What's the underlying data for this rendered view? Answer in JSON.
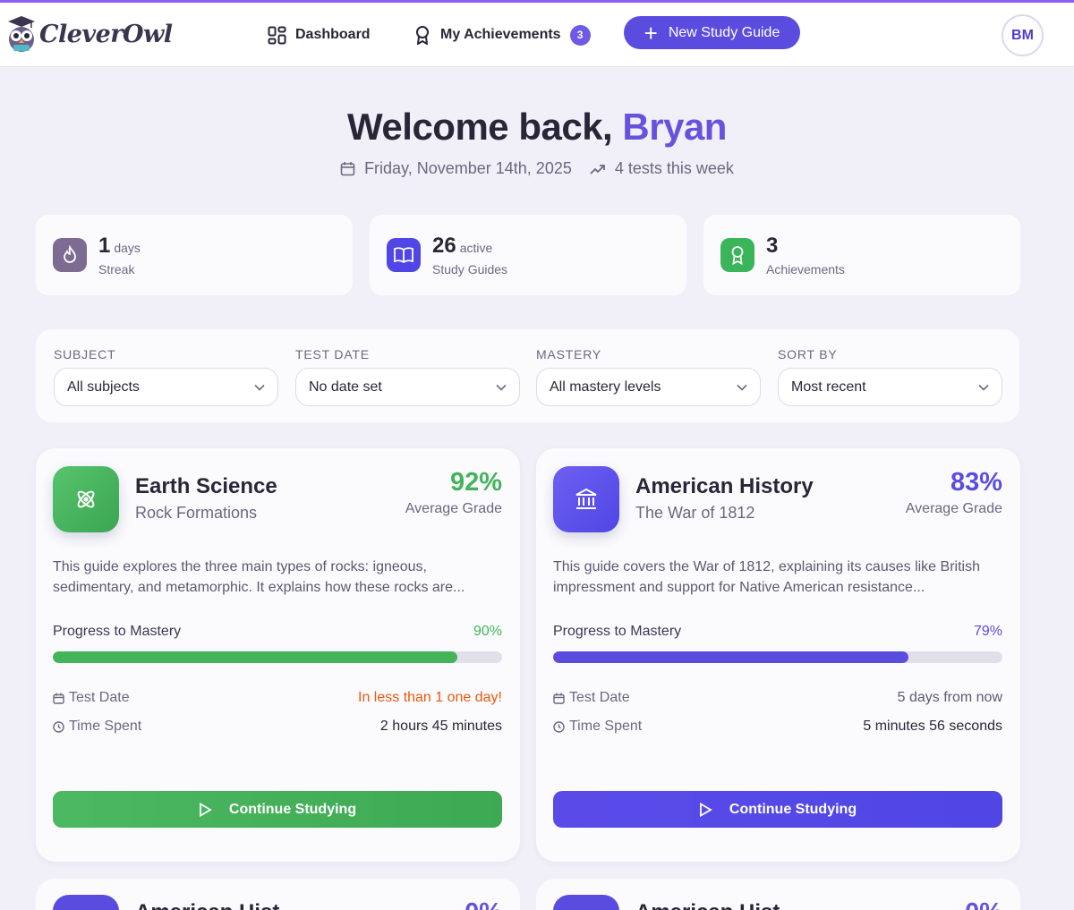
{
  "brand": {
    "name": "CleverOwl"
  },
  "nav": {
    "dashboard_label": "Dashboard",
    "achievements_label": "My Achievements",
    "achievements_count": "3",
    "new_guide_label": "New Study Guide",
    "avatar_initials": "BM"
  },
  "welcome": {
    "greeting": "Welcome back, ",
    "name": "Bryan",
    "date": "Friday, November 14th, 2025",
    "tests": "4 tests this week"
  },
  "stats": [
    {
      "value": "1",
      "unit": "days",
      "label": "Streak",
      "color": "#7d6b91",
      "icon": "flame-icon"
    },
    {
      "value": "26",
      "unit": "active",
      "label": "Study Guides",
      "color": "#4f46e5",
      "icon": "book-icon"
    },
    {
      "value": "3",
      "unit": "",
      "label": "Achievements",
      "color": "#3bb55a",
      "icon": "award-icon"
    }
  ],
  "filters": [
    {
      "label": "SUBJECT",
      "value": "All subjects"
    },
    {
      "label": "TEST DATE",
      "value": "No date set"
    },
    {
      "label": "MASTERY",
      "value": "All mastery levels"
    },
    {
      "label": "SORT BY",
      "value": "Most recent"
    }
  ],
  "guides": [
    {
      "subject": "Earth Science",
      "topic": "Rock Formations",
      "grade": "92%",
      "grade_label": "Average Grade",
      "description": "This guide explores the three main types of rocks: igneous, sedimentary, and metamorphic. It explains how these rocks are...",
      "progress_label": "Progress to Mastery",
      "progress_text": "90%",
      "progress": 0.9,
      "test_date_label": "Test Date",
      "test_date": "In less than 1 one day!",
      "time_label": "Time Spent",
      "time": "2 hours 45 minutes",
      "button": "Continue Studying",
      "accent": "#43b45a",
      "icon": "atom-icon"
    },
    {
      "subject": "American History",
      "topic": "The War of 1812",
      "grade": "83%",
      "grade_label": "Average Grade",
      "description": "This guide covers the War of 1812, explaining its causes like British impressment and support for Native American resistance...",
      "progress_label": "Progress to Mastery",
      "progress_text": "79%",
      "progress": 0.79,
      "test_date_label": "Test Date",
      "test_date": "5 days from now",
      "time_label": "Time Spent",
      "time": "5 minutes 56 seconds",
      "button": "Continue Studying",
      "accent": "#5b4ce0",
      "icon": "bank-icon"
    }
  ],
  "peek_cards": [
    {
      "subject": "American Hist",
      "grade": "0%"
    },
    {
      "subject": "American Hist",
      "grade": "0%"
    }
  ],
  "colors": {
    "brand_purple": "#5b4ce0",
    "urgent_orange": "#ea580c",
    "green": "#43b45a"
  }
}
